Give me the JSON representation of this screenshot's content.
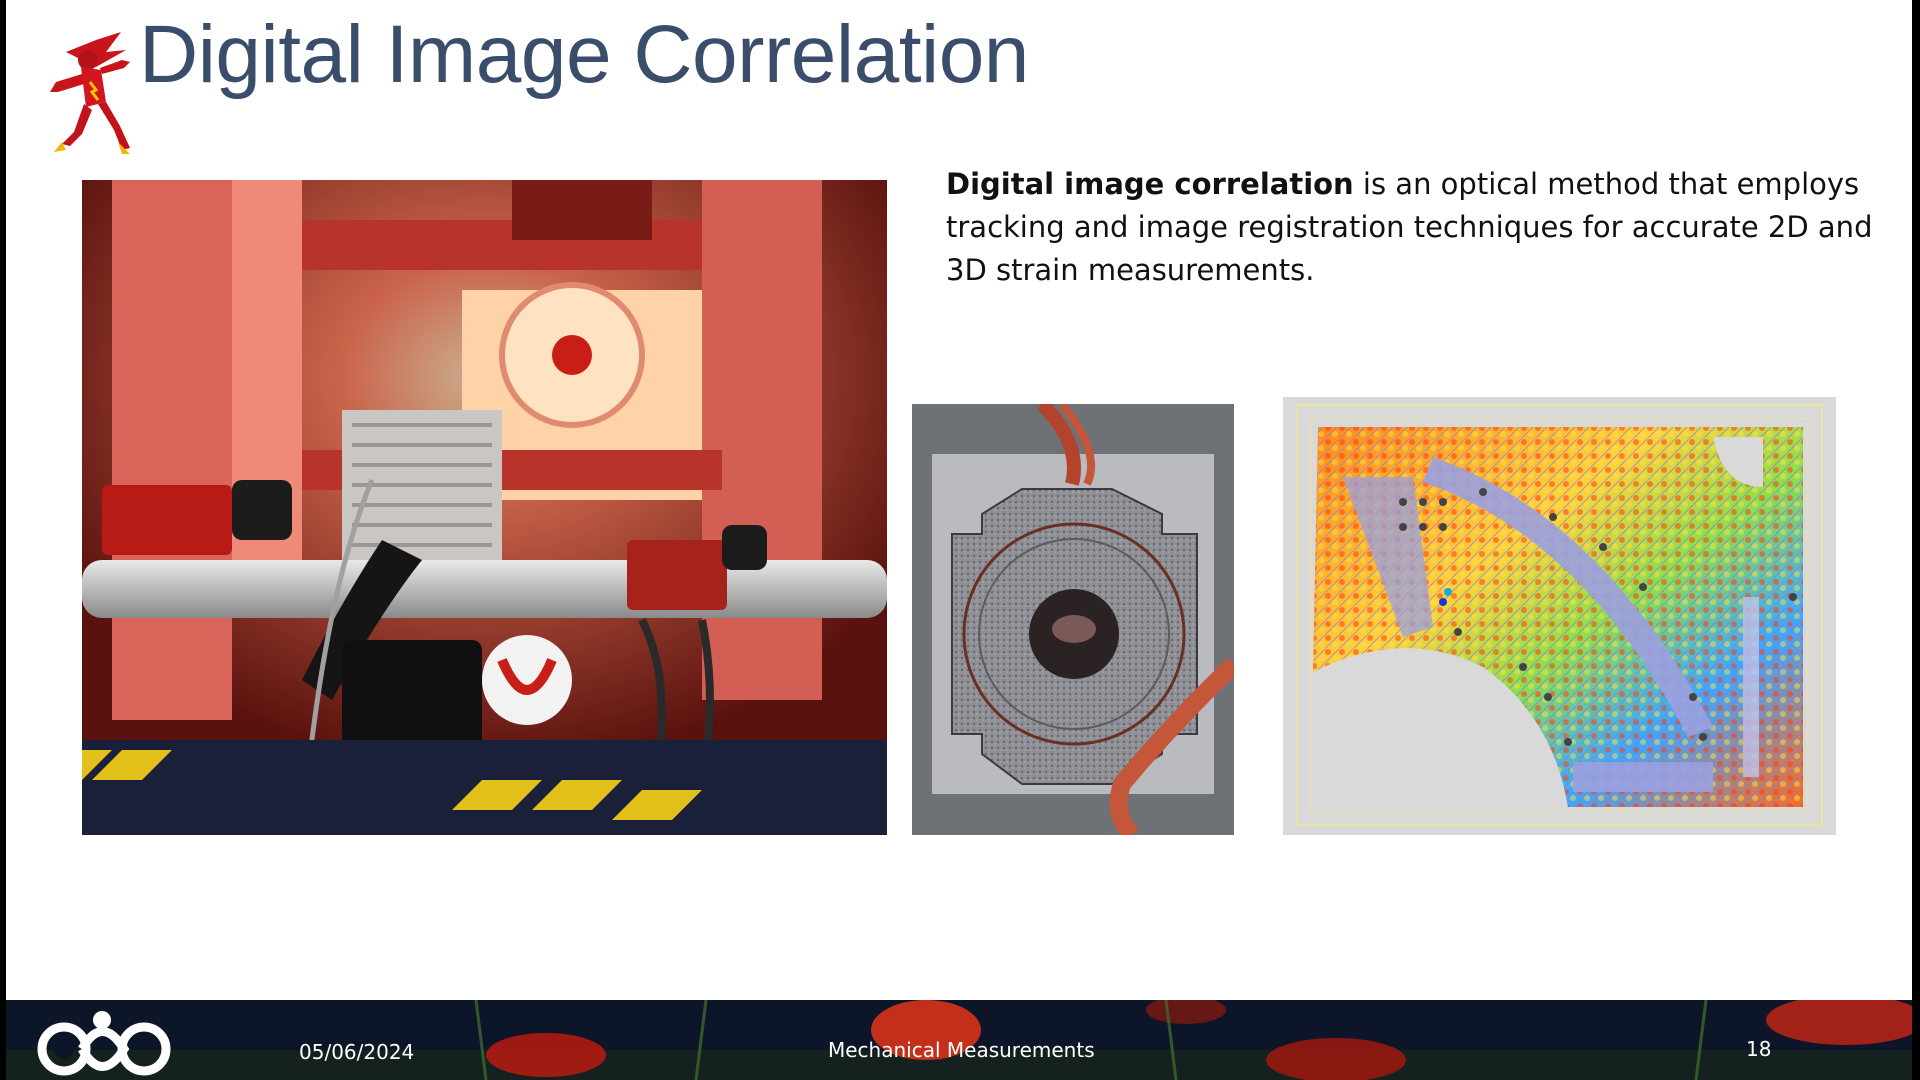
{
  "slide": {
    "title": "Digital Image Correlation",
    "description_bold": "Digital image correlation",
    "description_rest": " is an optical method that employs tracking and image registration techniques for accurate 2D and 3D strain measurements.",
    "mascot_icon": "flash-runner-icon"
  },
  "images": {
    "left": "lab-test-rig-photo",
    "middle": "speckle-specimen-photo",
    "right": "strain-map-image"
  },
  "footer": {
    "logo_icon": "institute-logo-icon",
    "date": "05/06/2024",
    "course": "Mechanical Measurements",
    "page_number": "18"
  },
  "colors": {
    "title": "#3a4d6b",
    "text": "#111111",
    "footer_text": "#ffffff"
  }
}
